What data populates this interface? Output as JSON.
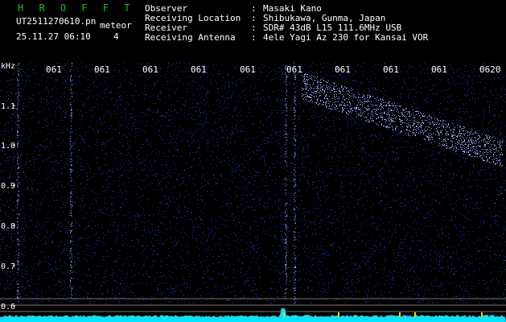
{
  "header": {
    "brand": "H R O F F T",
    "file_name": "UT2511270610.pn",
    "tag": "meteor",
    "datetime": "25.11.27 06:10",
    "count": "4",
    "info": [
      {
        "label": "Observer",
        "value": "Masaki Kano"
      },
      {
        "label": "Receiving Location",
        "value": "Shibukawa, Gunma, Japan"
      },
      {
        "label": "Receiver",
        "value": "SDR# 43dB L15 111.6MHz USB"
      },
      {
        "label": "Receiving Antenna",
        "value": "4ele Yagi Az 230 for Kansai VOR"
      }
    ],
    "separator": ":"
  },
  "chart_data": {
    "type": "heatmap",
    "ylabel": "kHz",
    "y_ticks": [
      "1.1",
      "1.0",
      "0.9",
      "0.8",
      "0.7",
      "0.6"
    ],
    "x_ticks": [
      "061",
      "061",
      "061",
      "061",
      "061",
      "061",
      "061",
      "061",
      "061",
      "0620"
    ],
    "palette": {
      "background": "#000000",
      "noise": "#1f2fbf",
      "signal": "#a9b8ff",
      "grid": "#d0d0d0",
      "power": "#00e5ff",
      "text": "#ffffff"
    }
  }
}
